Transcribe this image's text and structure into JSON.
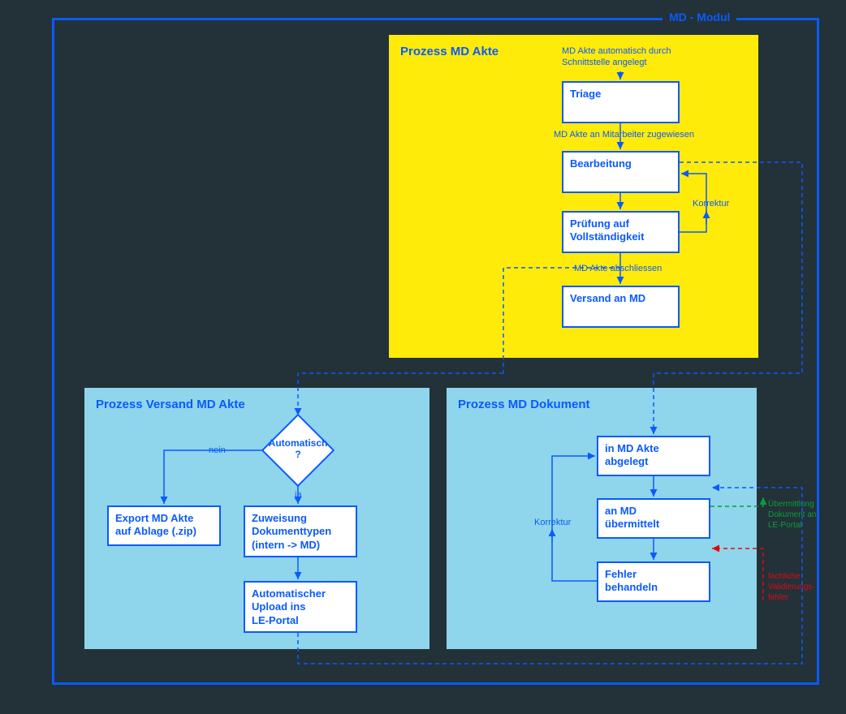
{
  "module": {
    "label": "MD - Modul"
  },
  "proc_akte": {
    "title": "Prozess MD Akte",
    "note1": "MD Akte automatisch durch\nSchnittstelle angelegt",
    "box_triage": "Triage",
    "label_assign": "MD Akte an Mitarbeiter zugewiesen",
    "box_bearbeitung": "Bearbeitung",
    "box_pruefung": "Prüfung auf\nVollständigkeit",
    "label_korrektur": "Korrektur",
    "label_abschliessen": "MD Akte abschliessen",
    "box_versand": "Versand an MD"
  },
  "proc_versand": {
    "title": "Prozess Versand MD Akte",
    "diamond": "Automatisch\n?",
    "label_nein": "nein",
    "label_ja": "ja",
    "box_export": "Export MD Akte\nauf Ablage (.zip)",
    "box_zuweisung": "Zuweisung\nDokumenttypen\n(intern -> MD)",
    "box_upload": "Automatischer\nUpload ins\nLE-Portal"
  },
  "proc_dokument": {
    "title": "Prozess MD Dokument",
    "box_abgelegt": "in MD Akte\nabgelegt",
    "box_uebermittelt": "an MD\nübermittelt",
    "box_fehler": "Fehler\nbehandeln",
    "label_korrektur": "Korrektur"
  },
  "external": {
    "green": "Übermittlung\nDokument an\nLE-Portal",
    "red": "fachliche\nValidierungs-\nfehler"
  }
}
